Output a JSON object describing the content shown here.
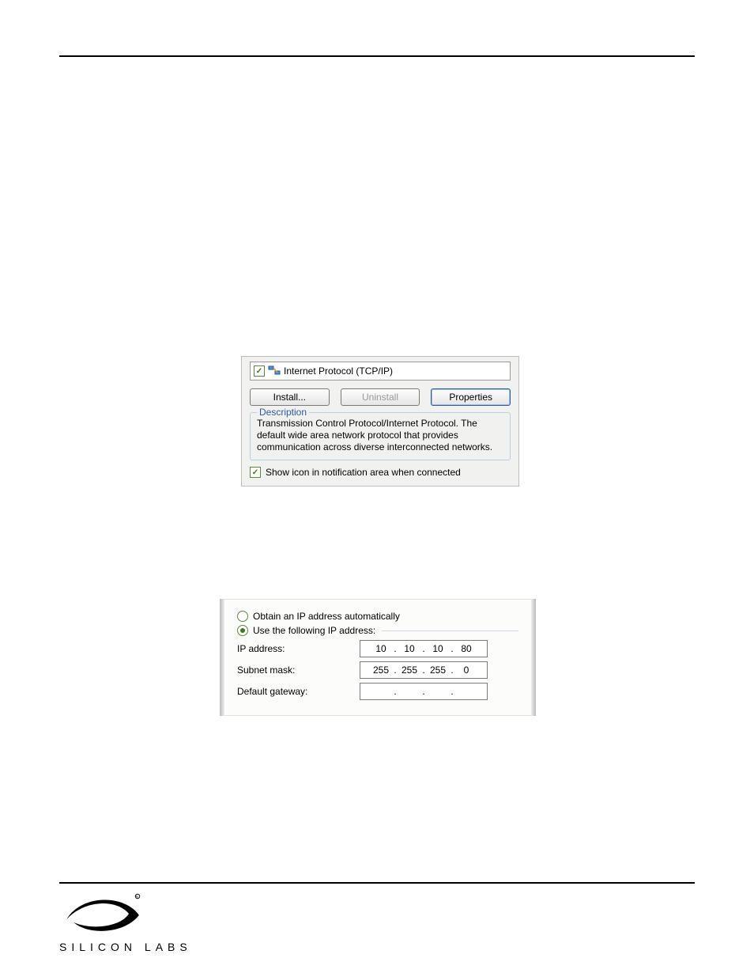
{
  "figure1": {
    "list_item": "Internet Protocol (TCP/IP)",
    "buttons": {
      "install": "Install...",
      "uninstall": "Uninstall",
      "properties": "Properties"
    },
    "description_title": "Description",
    "description_body": "Transmission Control Protocol/Internet Protocol. The default wide area network protocol that provides communication across diverse interconnected networks.",
    "show_icon": "Show icon in notification area when connected"
  },
  "figure2": {
    "radio_auto": "Obtain an IP address automatically",
    "radio_manual": "Use the following IP address:",
    "rows": [
      {
        "label": "IP address:",
        "oct": [
          "10",
          "10",
          "10",
          "80"
        ]
      },
      {
        "label": "Subnet mask:",
        "oct": [
          "255",
          "255",
          "255",
          "0"
        ]
      },
      {
        "label": "Default gateway:",
        "oct": [
          "",
          "",
          "",
          ""
        ]
      }
    ]
  },
  "footer": {
    "brand_text": "SILICON LABS"
  }
}
